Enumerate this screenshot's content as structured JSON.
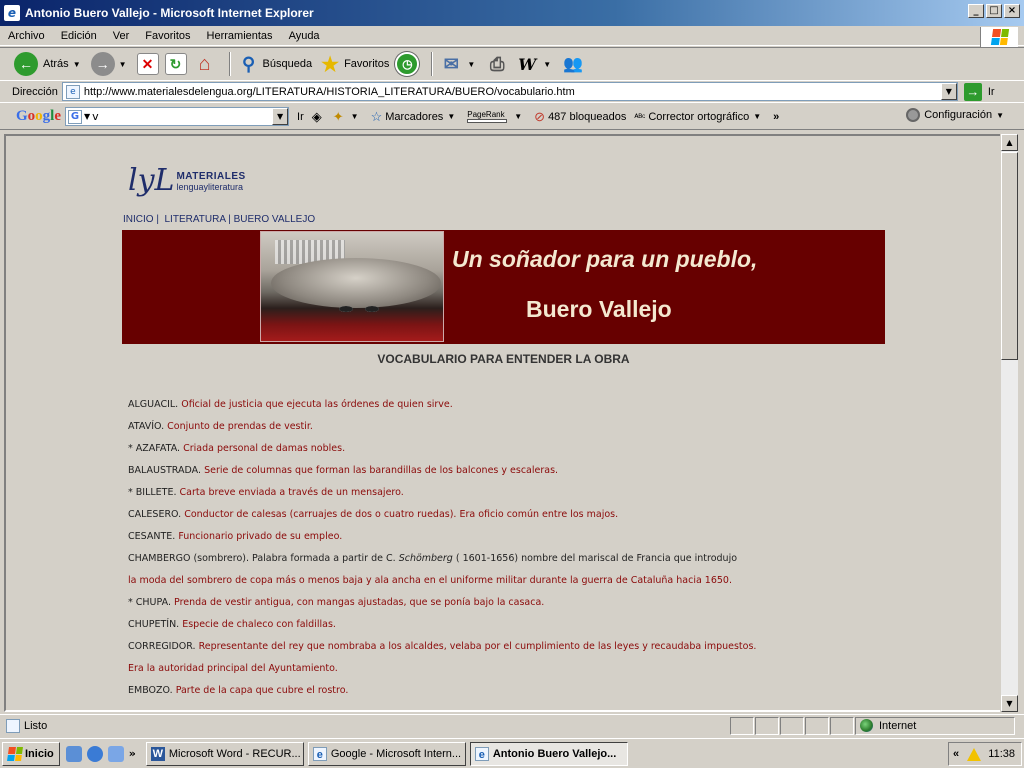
{
  "window": {
    "title": "Antonio Buero Vallejo - Microsoft Internet Explorer",
    "min": "_",
    "max": "□",
    "close": "×"
  },
  "menu": [
    "Archivo",
    "Edición",
    "Ver",
    "Favoritos",
    "Herramientas",
    "Ayuda"
  ],
  "toolbar": {
    "back": "Atrás",
    "search": "Búsqueda",
    "favorites": "Favoritos"
  },
  "address": {
    "label": "Dirección",
    "url": "http://www.materialesdelengua.org/LITERATURA/HISTORIA_LITERATURA/BUERO/vocabulario.htm",
    "go": "Ir"
  },
  "google_bar": {
    "logo": [
      "G",
      "o",
      "o",
      "g",
      "l",
      "e"
    ],
    "search_value": "v",
    "go": "Ir",
    "bookmarks": "Marcadores",
    "pagerank": "PageRank",
    "blocked": "487 bloqueados",
    "spell": "Corrector ortográfico",
    "more": "»",
    "settings": "Configuración"
  },
  "page": {
    "logo_mark": "lyL",
    "logo_title": "MATERIALES",
    "logo_sub": "lenguayliteratura",
    "breadcrumb": [
      "INICIO",
      "LITERATURA",
      "BUERO VALLEJO"
    ],
    "banner_line1": "Un soñador para un pueblo,",
    "banner_line2": "Buero Vallejo",
    "heading": "VOCABULARIO PARA ENTENDER LA OBRA",
    "vocab": [
      {
        "term": "ALGUACIL.",
        "def": "Oficial de justicia que ejecuta las órdenes de quien sirve."
      },
      {
        "term": "ATAVÍO.",
        "def": "Conjunto de prendas de vestir."
      },
      {
        "term": "* AZAFATA.",
        "def": "Criada personal de damas nobles."
      },
      {
        "term": "BALAUSTRADA.",
        "def": "Serie de columnas que forman las barandillas de los balcones y escaleras."
      },
      {
        "term": "* BILLETE.",
        "def": "Carta breve enviada a través de un mensajero."
      },
      {
        "term": "CALESERO.",
        "def": "Conductor de calesas (carruajes de dos o cuatro ruedas). Era oficio común entre los majos."
      },
      {
        "term": "CESANTE.",
        "def": "Funcionario privado de su empleo."
      },
      {
        "term": "CHAMBERGO",
        "pre": "(sombrero). Palabra formada a partir de C. ",
        "name": "Schömberg",
        "post": " ( 1601-1656) nombre del mariscal de Francia que introdujo"
      },
      {
        "term": "",
        "def": "la moda del sombrero de copa más o menos baja y ala ancha en el uniforme militar durante la guerra de Cataluña hacia 1650."
      },
      {
        "term": "* CHUPA.",
        "def": "Prenda de vestir antigua, con mangas ajustadas, que se ponía bajo la casaca."
      },
      {
        "term": "CHUPETÍN.",
        "def": "Especie de chaleco con faldillas."
      },
      {
        "term": "CORREGIDOR.",
        "def": "Representante del rey que nombraba a los alcaldes, velaba por el cumplimiento de las leyes y recaudaba impuestos."
      },
      {
        "term": "",
        "def": "Era la autoridad principal del Ayuntamiento."
      },
      {
        "term": "EMBOZO.",
        "def": "Parte de la capa que cubre el rostro."
      }
    ]
  },
  "status": {
    "text": "Listo",
    "zone": "Internet"
  },
  "taskbar": {
    "start": "Inicio",
    "more": "»",
    "tasks": [
      "Microsoft Word - RECUR...",
      "Google - Microsoft Intern...",
      "Antonio Buero Vallejo..."
    ],
    "tray_more": "«",
    "clock": "11:38"
  },
  "icons": [
    "ie-icon",
    "back-icon",
    "forward-icon",
    "stop-icon",
    "refresh-icon",
    "home-icon",
    "search-icon",
    "favorites-icon",
    "history-icon",
    "mail-icon",
    "print-icon",
    "word-icon",
    "messenger-icon",
    "windows-flag-icon"
  ]
}
